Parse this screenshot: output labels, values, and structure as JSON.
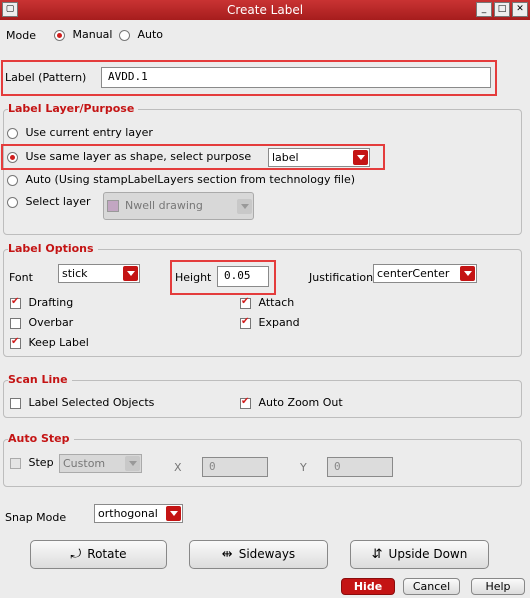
{
  "window": {
    "title": "Create Label"
  },
  "mode": {
    "label": "Mode",
    "options": [
      "Manual",
      "Auto"
    ],
    "selected": "Manual"
  },
  "label_pattern": {
    "label": "Label (Pattern)",
    "value": "AVDD.1"
  },
  "layer_purpose": {
    "title": "Label Layer/Purpose",
    "opt_current": "Use current entry layer",
    "opt_same": "Use same layer as shape, select purpose",
    "purpose_value": "label",
    "opt_auto": "Auto (Using stampLabelLayers section from technology file)",
    "opt_select": "Select layer",
    "layer_value": "Nwell drawing",
    "selected": "Use same layer as shape, select purpose"
  },
  "label_options": {
    "title": "Label Options",
    "font_label": "Font",
    "font_value": "stick",
    "height_label": "Height",
    "height_value": "0.05",
    "justification_label": "Justification",
    "justification_value": "centerCenter",
    "drafting": "Drafting",
    "overbar": "Overbar",
    "keep_label": "Keep Label",
    "attach": "Attach",
    "expand": "Expand"
  },
  "scan_line": {
    "title": "Scan Line",
    "label_selected": "Label Selected Objects",
    "auto_zoom": "Auto Zoom Out"
  },
  "auto_step": {
    "title": "Auto Step",
    "step_label": "Step",
    "step_value": "Custom",
    "x_label": "X",
    "x_value": "0",
    "y_label": "Y",
    "y_value": "0"
  },
  "snap": {
    "label": "Snap Mode",
    "value": "orthogonal"
  },
  "buttons": {
    "rotate": "Rotate",
    "sideways": "Sideways",
    "upside_down": "Upside Down",
    "hide": "Hide",
    "cancel": "Cancel",
    "help": "Help"
  },
  "colors": {
    "accent": "#c41414",
    "highlight": "#e43c3c",
    "titlebar": "#b32424"
  }
}
